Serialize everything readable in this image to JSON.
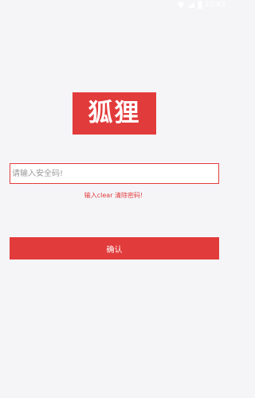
{
  "status_bar": {
    "time": "10:43",
    "icons": [
      "wifi-icon",
      "signal-icon",
      "battery-icon"
    ]
  },
  "logo": {
    "text": "狐狸"
  },
  "security": {
    "placeholder": "请输入安全码!",
    "value": ""
  },
  "hint": {
    "text": "输入clear 清除密码!"
  },
  "confirm_button": {
    "label": "确认"
  },
  "colors": {
    "accent": "#e23b3b",
    "background": "#f5f5f8",
    "button_text": "#ffffff"
  }
}
